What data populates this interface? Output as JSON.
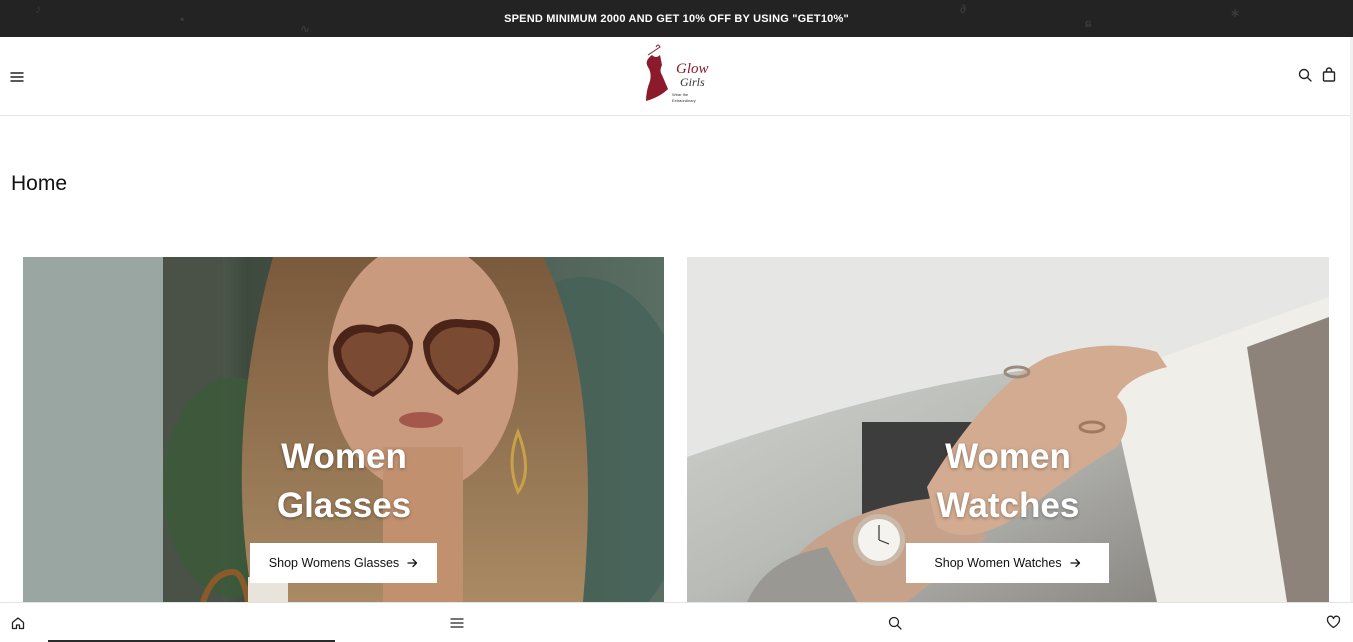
{
  "announcement": {
    "text": "SPEND MINIMUM 2000 AND GET 10% OFF BY USING \"GET10%\""
  },
  "header": {
    "menu_icon": "hamburger-menu-icon",
    "logo": {
      "brand": "Glow Girls",
      "tagline": "Wear the Extraordinary",
      "color": "#8b1a2b"
    },
    "search_icon": "search-icon",
    "cart_icon": "shopping-bag-icon"
  },
  "page": {
    "title": "Home"
  },
  "banners": [
    {
      "heading_line1": "Women",
      "heading_line2": "Glasses",
      "button_label": "Shop Womens Glasses",
      "button_icon": "arrow-right-icon"
    },
    {
      "heading_line1": "Women",
      "heading_line2": "Watches",
      "button_label": "Shop Women Watches",
      "button_icon": "arrow-right-icon"
    }
  ],
  "bottom_nav": {
    "items": [
      "home-icon",
      "menu-icon",
      "search-icon",
      "heart-icon"
    ]
  },
  "colors": {
    "announcement_bg": "#232323",
    "brand": "#8b1a2b",
    "text": "#111111"
  }
}
